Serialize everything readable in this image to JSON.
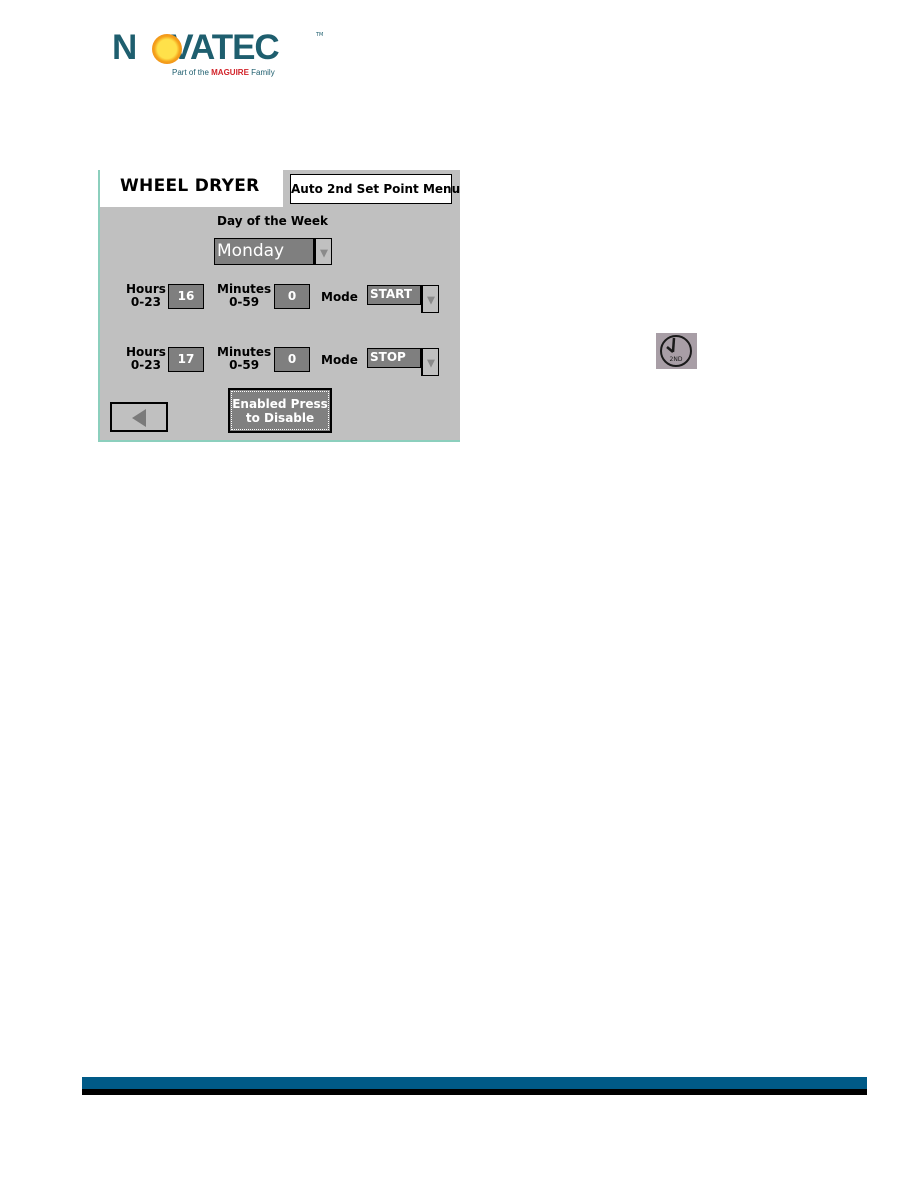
{
  "logo": {
    "wordmark_left": "N",
    "wordmark_right": "VATEC",
    "trademark": "TM",
    "tagline_prefix": "Part of the ",
    "tagline_brand": "MAGUIRE",
    "tagline_suffix": " Family",
    "colors": {
      "primary": "#1e5e6e",
      "brand_accent": "#d2232a",
      "sun": "#f5a21a"
    }
  },
  "hmi": {
    "title": "WHEEL DRYER",
    "menu_button": "Auto 2nd Set Point Menu",
    "day_label": "Day of the Week",
    "day_value": "Monday",
    "rows": [
      {
        "hours_label_1": "Hours",
        "hours_label_2": "0-23",
        "hours": "16",
        "minutes_label_1": "Minutes",
        "minutes_label_2": "0-59",
        "minutes": "0",
        "mode_label": "Mode",
        "mode": "START"
      },
      {
        "hours_label_1": "Hours",
        "hours_label_2": "0-23",
        "hours": "17",
        "minutes_label_1": "Minutes",
        "minutes_label_2": "0-59",
        "minutes": "0",
        "mode_label": "Mode",
        "mode": "STOP"
      }
    ],
    "toggle_line_1": "Enabled Press",
    "toggle_line_2": "to Disable",
    "back_icon": "left-triangle-icon"
  },
  "clock_icon": {
    "label": "2ND",
    "icon": "clock-2nd-icon"
  },
  "footer": {
    "bar_color": "#005a87",
    "shadow_color": "#000000"
  }
}
